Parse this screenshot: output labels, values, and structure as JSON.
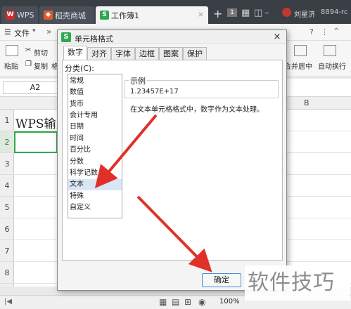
{
  "tabs": [
    {
      "label": "WPS",
      "icon": "wps-logo-icon",
      "active": false
    },
    {
      "label": "稻壳商城",
      "icon": "docer-icon",
      "active": false
    },
    {
      "label": "工作簿1",
      "icon": "spreadsheet-icon",
      "active": true
    }
  ],
  "titlebar": {
    "add": "+",
    "badge": "1",
    "user": "刘星济",
    "user_id": "8894-rc"
  },
  "menu": {
    "file_label": "文件",
    "chevron": "»"
  },
  "ribbon": {
    "cut": "剪切",
    "copy": "复制",
    "paste": "粘贴",
    "format_partial": "格",
    "merge_center": "合并居中",
    "wrap_text": "自动换行"
  },
  "formula_bar": {
    "name_box": "A2"
  },
  "columns": {
    "col_b": "B"
  },
  "rows": [
    "1",
    "2",
    "3",
    "4",
    "5",
    "6",
    "7",
    "8"
  ],
  "cell_a1": "WPS输入",
  "dialog": {
    "title": "单元格格式",
    "tabs": [
      "数字",
      "对齐",
      "字体",
      "边框",
      "图案",
      "保护"
    ],
    "active_tab": "数字",
    "category_label": "分类(C):",
    "categories": [
      "常规",
      "数值",
      "货币",
      "会计专用",
      "日期",
      "时间",
      "百分比",
      "分数",
      "科学记数",
      "文本",
      "特殊",
      "自定义"
    ],
    "selected_category": "文本",
    "sample_label": "示例",
    "sample_value": "1.23457E+17",
    "description": "在文本单元格格式中，数字作为文本处理。",
    "ok": "确定",
    "close": "×"
  },
  "status": {
    "zoom": "100%"
  },
  "watermark": "软件技巧",
  "colors": {
    "accent_green": "#2fa84f",
    "titlebar": "#3a3f45",
    "arrow_red": "#e0302a",
    "selected_blue": "#d9e6f5"
  }
}
